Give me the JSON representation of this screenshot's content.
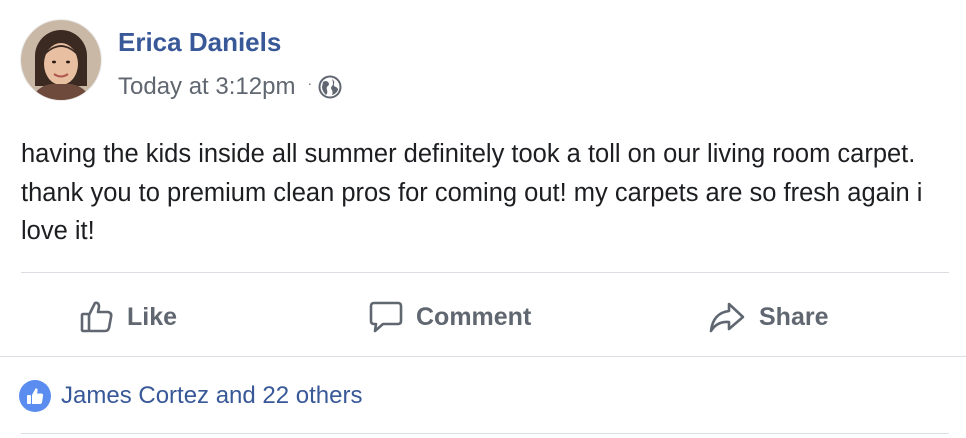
{
  "post": {
    "author": "Erica Daniels",
    "timestamp": "Today at 3:12pm",
    "separator": "·",
    "privacy_icon": "globe-icon",
    "text": "having the kids inside all summer definitely took a toll on our living room carpet. thank you to premium clean pros for coming out! my carpets are so fresh again i love it!"
  },
  "actions": [
    {
      "label": "Like",
      "icon": "thumbs-up-icon"
    },
    {
      "label": "Comment",
      "icon": "speech-bubble-icon"
    },
    {
      "label": "Share",
      "icon": "share-arrow-icon"
    }
  ],
  "reactions": {
    "text": "James Cortez and 22 others",
    "icon": "like-badge-icon"
  },
  "colors": {
    "author": "#385898",
    "secondary_text": "#606770",
    "body_text": "#1c1e21",
    "divider": "#dadde1",
    "like_badge": "#5b8df0"
  }
}
